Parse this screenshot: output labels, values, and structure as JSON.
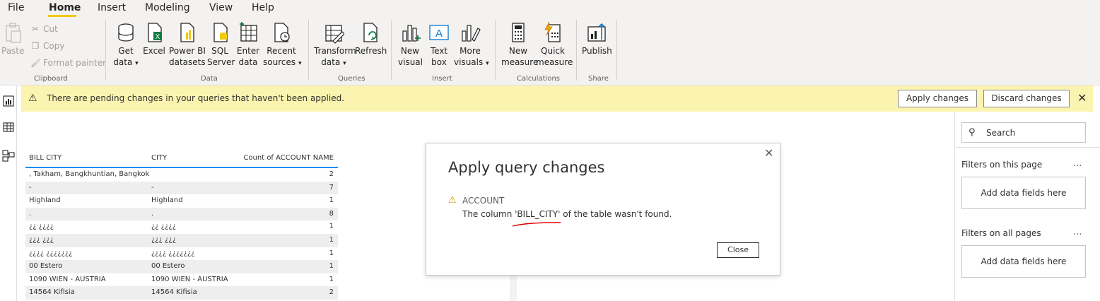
{
  "menu": {
    "tabs": [
      {
        "label": "File"
      },
      {
        "label": "Home"
      },
      {
        "label": "Insert"
      },
      {
        "label": "Modeling"
      },
      {
        "label": "View"
      },
      {
        "label": "Help"
      }
    ],
    "active_tab": "Home"
  },
  "ribbon": {
    "clipboard": {
      "paste": "Paste",
      "cut": "Cut",
      "copy": "Copy",
      "format_painter": "Format painter",
      "group_label": "Clipboard"
    },
    "data": {
      "get_data_1": "Get",
      "get_data_2": "data",
      "excel": "Excel",
      "pbi_1": "Power BI",
      "pbi_2": "datasets",
      "sql_1": "SQL",
      "sql_2": "Server",
      "enter_1": "Enter",
      "enter_2": "data",
      "recent_1": "Recent",
      "recent_2": "sources",
      "group_label": "Data"
    },
    "queries": {
      "transform_1": "Transform",
      "transform_2": "data",
      "refresh": "Refresh",
      "group_label": "Queries"
    },
    "insert": {
      "new_visual_1": "New",
      "new_visual_2": "visual",
      "text_box_1": "Text",
      "text_box_2": "box",
      "more_visuals_1": "More",
      "more_visuals_2": "visuals",
      "group_label": "Insert"
    },
    "calculations": {
      "new_measure_1": "New",
      "new_measure_2": "measure",
      "quick_measure_1": "Quick",
      "quick_measure_2": "measure",
      "group_label": "Calculations"
    },
    "share": {
      "publish": "Publish",
      "group_label": "Share"
    }
  },
  "warning_bar": {
    "message": "There are pending changes in your queries that haven't been applied.",
    "apply_label": "Apply changes",
    "discard_label": "Discard changes"
  },
  "table": {
    "headers": [
      "BILL CITY",
      "CITY",
      "Count of ACCOUNT NAME"
    ],
    "rows": [
      {
        "bill_city": ", Takham, Bangkhuntian, Bangkok",
        "city": "",
        "count": "2"
      },
      {
        "bill_city": "-",
        "city": "-",
        "count": "7"
      },
      {
        "bill_city": " Highland",
        "city": " Highland",
        "count": "1"
      },
      {
        "bill_city": ".",
        "city": ".",
        "count": "8"
      },
      {
        "bill_city": "¿¿ ¿¿¿¿",
        "city": "¿¿ ¿¿¿¿",
        "count": "1"
      },
      {
        "bill_city": "¿¿¿ ¿¿¿",
        "city": "¿¿¿ ¿¿¿",
        "count": "1"
      },
      {
        "bill_city": "¿¿¿¿ ¿¿¿¿¿¿¿",
        "city": "¿¿¿¿ ¿¿¿¿¿¿¿",
        "count": "1"
      },
      {
        "bill_city": "00             Estero",
        "city": "00             Estero",
        "count": "1"
      },
      {
        "bill_city": "1090 WIEN - AUSTRIA",
        "city": "1090 WIEN - AUSTRIA",
        "count": "1"
      },
      {
        "bill_city": "14564 Kifisia",
        "city": "14564 Kifisia",
        "count": "2"
      }
    ]
  },
  "dialog": {
    "title": "Apply query changes",
    "entity": "ACCOUNT",
    "message": "The column 'BILL_CITY' of the table wasn't found.",
    "close_label": "Close"
  },
  "filters": {
    "search_placeholder": "Search",
    "on_this_page": "Filters on this page",
    "on_all_pages": "Filters on all pages",
    "add_fields": "Add data fields here",
    "more": "..."
  },
  "colors": {
    "accent_yellow": "#f2c811",
    "warning_bg": "#fbf4b0",
    "table_rule": "#118dff",
    "annotation_red": "#e00000"
  }
}
